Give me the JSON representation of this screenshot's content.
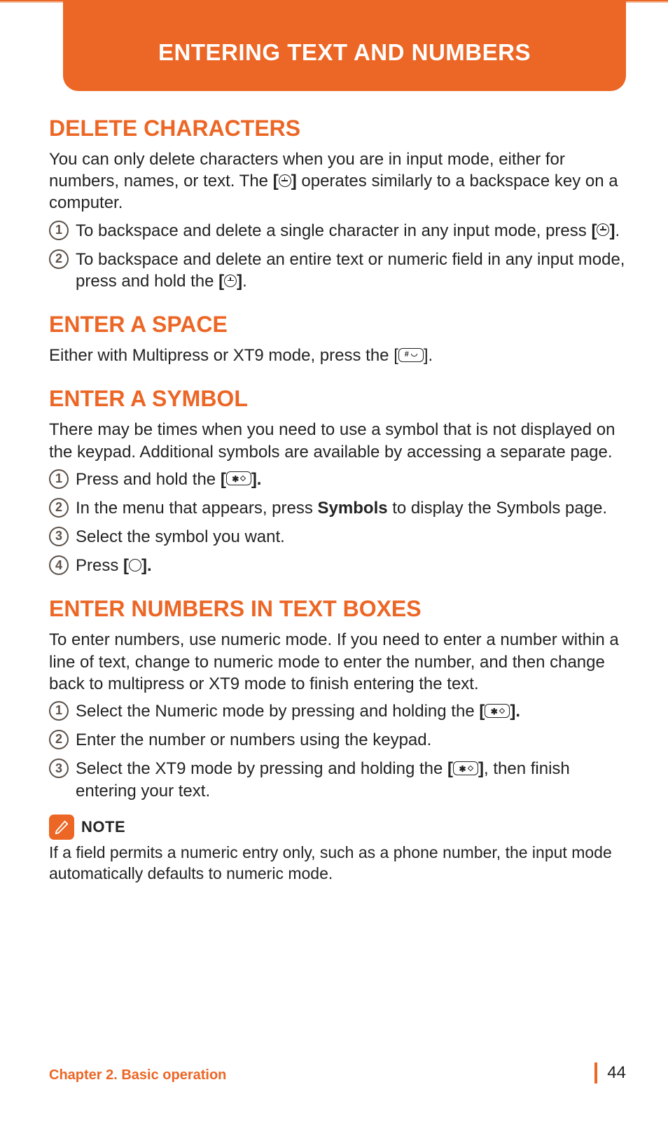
{
  "header": {
    "title": "ENTERING TEXT AND NUMBERS"
  },
  "sections": {
    "delete": {
      "heading": "DELETE CHARACTERS",
      "intro_pre": "You can only delete characters when you are in input mode, either for numbers, names, or text. The ",
      "intro_key_open": "[",
      "intro_key_close": "]",
      "intro_post": " operates similarly to a backspace key on a computer.",
      "steps": [
        {
          "pre": "To backspace and delete a single character in any input mode, press ",
          "post": "."
        },
        {
          "pre": "To backspace and delete an entire text or numeric field in any input mode, press and hold the ",
          "post": "."
        }
      ]
    },
    "space": {
      "heading": "ENTER A SPACE",
      "text_pre": "Either with Multipress or XT9 mode, press the [",
      "text_post": "]."
    },
    "symbol": {
      "heading": "ENTER A SYMBOL",
      "intro": "There may be times when you need to use a symbol that is not displayed on the keypad. Additional symbols are available by accessing a separate page.",
      "steps": {
        "s1_pre": "Press and hold the ",
        "s1_open": "[",
        "s1_close": "].",
        "s2_pre": "In the menu that appears, press ",
        "s2_bold": "Symbols",
        "s2_post": " to display the Symbols page.",
        "s3": "Select the symbol you want.",
        "s4_pre": "Press ",
        "s4_open": "[",
        "s4_close": "]."
      }
    },
    "numbers": {
      "heading": "ENTER NUMBERS IN TEXT BOXES",
      "intro": "To enter numbers, use numeric mode. If you need to enter a number within a line of text, change to numeric mode to enter the number, and then change back to multipress or XT9 mode to finish entering the text.",
      "steps": {
        "s1_pre": "Select the Numeric mode by pressing and holding the ",
        "s1_open": "[",
        "s1_close": "].",
        "s2": "Enter the number or numbers using the keypad.",
        "s3_pre": "Select the XT9 mode by pressing and holding the ",
        "s3_open": "[",
        "s3_close": "]",
        "s3_post": ", then finish entering your text."
      }
    }
  },
  "note": {
    "label": "NOTE",
    "text": "If a field permits a numeric entry only, such as a phone number, the input mode automatically defaults to numeric mode."
  },
  "footer": {
    "chapter": "Chapter 2. Basic operation",
    "page": "44"
  },
  "step_numbers": {
    "n1": "1",
    "n2": "2",
    "n3": "3",
    "n4": "4"
  }
}
